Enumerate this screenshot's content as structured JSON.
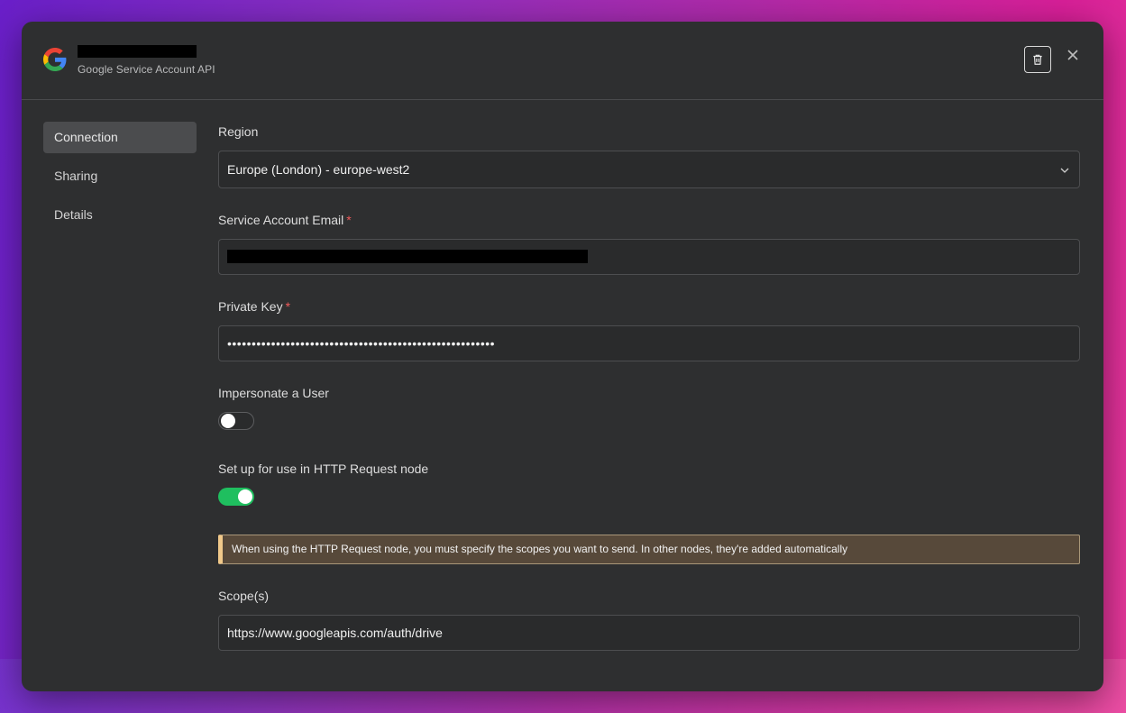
{
  "header": {
    "service_name": "Google Service Account API",
    "icons": {
      "logo": "google-logo",
      "delete": "trash-icon",
      "close": "close-icon"
    }
  },
  "sidebar": {
    "items": [
      {
        "label": "Connection",
        "active": true
      },
      {
        "label": "Sharing",
        "active": false
      },
      {
        "label": "Details",
        "active": false
      }
    ]
  },
  "form": {
    "region": {
      "label": "Region",
      "value": "Europe (London) - europe-west2"
    },
    "email": {
      "label": "Service Account Email",
      "required_mark": "*"
    },
    "private_key": {
      "label": "Private Key",
      "required_mark": "*",
      "value": "•••••••••••••••••••••••••••••••••••••••••••••••••••••••"
    },
    "impersonate": {
      "label": "Impersonate a User",
      "enabled": false
    },
    "http_request": {
      "label": "Set up for use in HTTP Request node",
      "enabled": true
    },
    "notice": "When using the HTTP Request node, you must specify the scopes you want to send. In other nodes, they're added automatically",
    "scopes": {
      "label": "Scope(s)",
      "value": "https://www.googleapis.com/auth/drive"
    }
  },
  "colors": {
    "toggle_on": "#1fbf5f",
    "notice_accent": "#f1c98a",
    "required": "#ef5a5a"
  }
}
